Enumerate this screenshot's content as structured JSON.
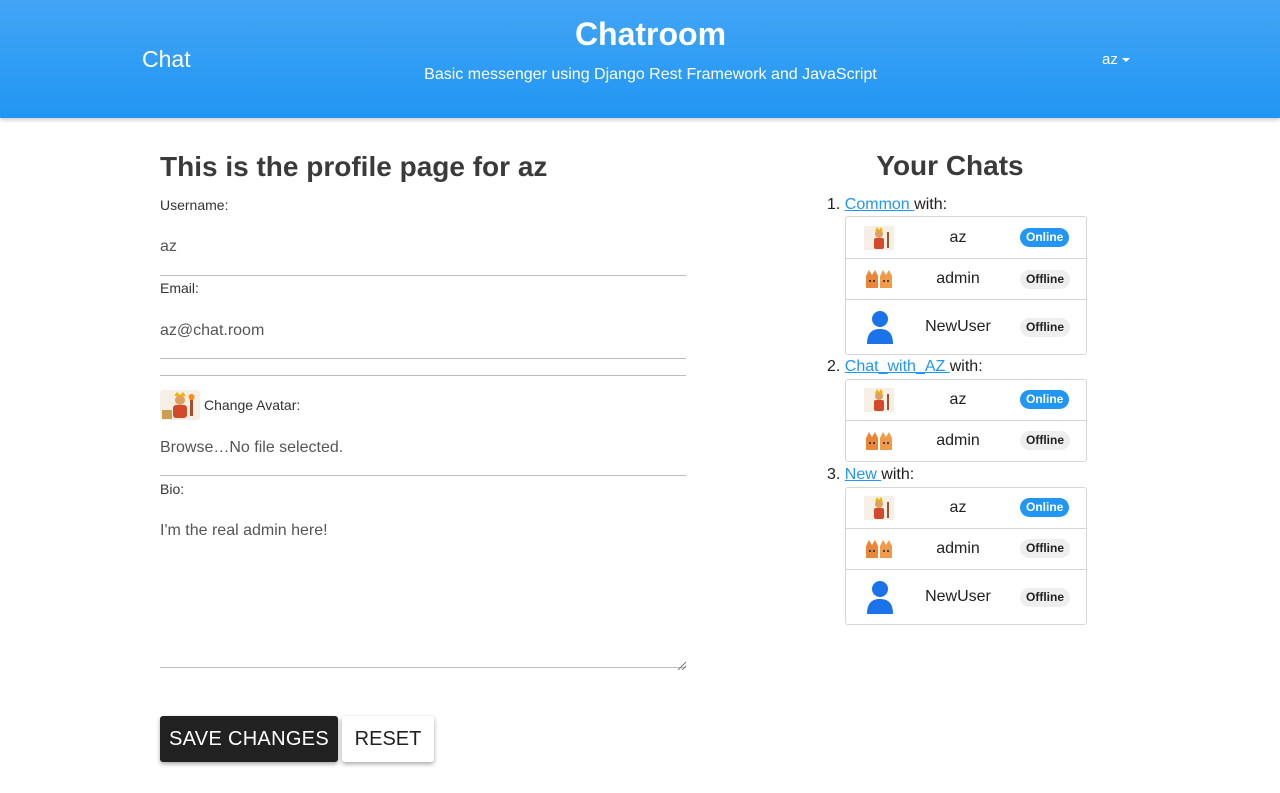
{
  "header": {
    "brand": "Chat",
    "title": "Chatroom",
    "subtitle": "Basic messenger using Django Rest Framework and JavaScript",
    "user_menu": "az"
  },
  "profile": {
    "heading": "This is the profile page for az",
    "username_label": "Username:",
    "username_value": "az",
    "email_label": "Email:",
    "email_value": "az@chat.room",
    "avatar_label": "Change Avatar:",
    "file_button": "Browse…",
    "file_status": "No file selected.",
    "bio_label": "Bio:",
    "bio_value": "I'm the real admin here!",
    "save_button": "SAVE CHANGES",
    "reset_button": "RESET"
  },
  "chats": {
    "heading": "Your Chats",
    "with_text": "with:",
    "list": [
      {
        "number": "1.",
        "name": "Common",
        "members": [
          {
            "name": "az",
            "status": "Online",
            "avatar": "king-avatar-icon"
          },
          {
            "name": "admin",
            "status": "Offline",
            "avatar": "cats-avatar-icon"
          },
          {
            "name": "NewUser",
            "status": "Offline",
            "avatar": "default-user-icon"
          }
        ]
      },
      {
        "number": "2.",
        "name": "Chat_with_AZ",
        "members": [
          {
            "name": "az",
            "status": "Online",
            "avatar": "king-avatar-icon"
          },
          {
            "name": "admin",
            "status": "Offline",
            "avatar": "cats-avatar-icon"
          }
        ]
      },
      {
        "number": "3.",
        "name": "New",
        "members": [
          {
            "name": "az",
            "status": "Online",
            "avatar": "king-avatar-icon"
          },
          {
            "name": "admin",
            "status": "Offline",
            "avatar": "cats-avatar-icon"
          },
          {
            "name": "NewUser",
            "status": "Offline",
            "avatar": "default-user-icon"
          }
        ]
      }
    ]
  },
  "colors": {
    "primary": "#2196f3",
    "header_top": "#42a5f5",
    "dark_button": "#212121",
    "offline_badge": "#eeeeee"
  }
}
